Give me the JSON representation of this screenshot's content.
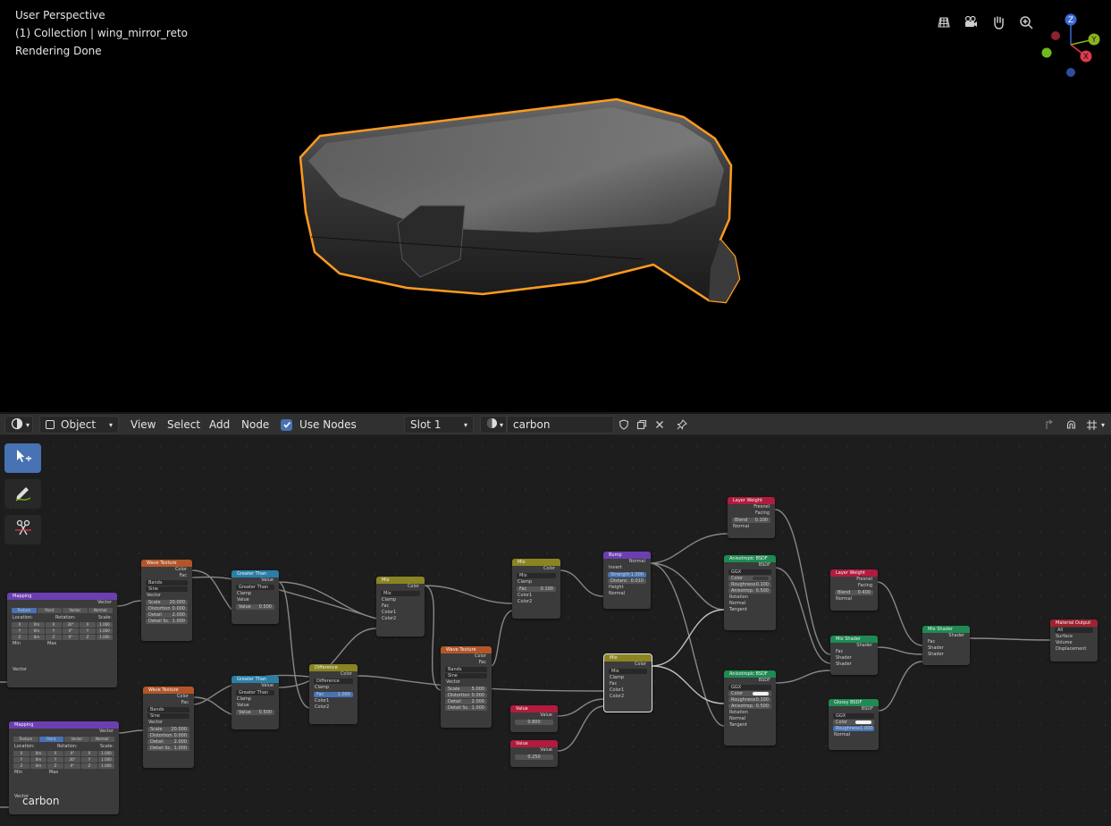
{
  "viewport": {
    "info_lines": [
      "User Perspective",
      "(1) Collection | wing_mirror_reto",
      "Rendering Done"
    ],
    "nav_buttons": [
      "grid-icon",
      "camera-icon",
      "hand-icon",
      "zoom-icon"
    ],
    "gizmo_axes": {
      "z": "Z",
      "y": "Y",
      "x": "X"
    }
  },
  "header": {
    "editor_type_icon": "shader-editor-icon",
    "mode": "Object",
    "menus": [
      "View",
      "Select",
      "Add",
      "Node"
    ],
    "use_nodes_label": "Use Nodes",
    "slot": "Slot 1",
    "material_name": "carbon"
  },
  "tools": [
    "select-box-icon",
    "annotate-icon",
    "cut-links-icon"
  ],
  "material_label": "carbon",
  "nodes": {
    "mapping1": {
      "title": "Mapping",
      "out": "Vector",
      "tabs": [
        "Texture",
        "Point",
        "Vector",
        "Normal"
      ],
      "loc": "Location:",
      "rot": "Rotation:",
      "scl": "Scale:",
      "rows": [
        [
          "X",
          "0m",
          "X",
          "30°",
          "X",
          "1.000"
        ],
        [
          "Y",
          "0m",
          "Y",
          "0°",
          "Y",
          "1.000"
        ],
        [
          "Z",
          "0m",
          "Z",
          "0°",
          "Z",
          "1.000"
        ]
      ],
      "min": "Min",
      "max": "Max",
      "in": "Vector"
    },
    "mapping2": {
      "title": "Mapping",
      "out": "Vector",
      "tabs": [
        "Texture",
        "Point",
        "Vector",
        "Normal"
      ],
      "loc": "Location:",
      "rot": "Rotation:",
      "scl": "Scale:",
      "rows": [
        [
          "X",
          "0m",
          "X",
          "0°",
          "X",
          "1.000"
        ],
        [
          "Y",
          "0m",
          "Y",
          "30°",
          "Y",
          "1.000"
        ],
        [
          "Z",
          "0m",
          "Z",
          "0°",
          "Z",
          "1.000"
        ]
      ],
      "min": "Min",
      "max": "Max",
      "in": "Vector"
    },
    "wave1": {
      "title": "Wave Texture",
      "out1": "Color",
      "out2": "Fac",
      "type": "Bands",
      "profile": "Sine",
      "in": "Vector",
      "scale": "Scale",
      "scale_v": "20.000",
      "dist": "Distortion",
      "dist_v": "0.000",
      "detail": "Detail",
      "detail_v": "2.000",
      "dscale": "Detail Sc.",
      "dscale_v": "1.000"
    },
    "wave2": {
      "title": "Wave Texture",
      "out1": "Color",
      "out2": "Fac",
      "type": "Bands",
      "profile": "Sine",
      "in": "Vector",
      "scale": "Scale",
      "scale_v": "20.000",
      "dist": "Distortion",
      "dist_v": "0.000",
      "detail": "Detail",
      "detail_v": "2.000",
      "dscale": "Detail Sc.",
      "dscale_v": "1.000"
    },
    "wave3": {
      "title": "Wave Texture",
      "out1": "Color",
      "out2": "Fac",
      "type": "Bands",
      "profile": "Sine",
      "in": "Vector",
      "scale": "Scale",
      "scale_v": "5.000",
      "dist": "Distortion",
      "dist_v": "0.000",
      "detail": "Detail",
      "detail_v": "2.000",
      "dscale": "Detail Sc.",
      "dscale_v": "1.000"
    },
    "gt1": {
      "title": "Greater Than",
      "out": "Value",
      "op": "Greater Than",
      "clamp": "Clamp",
      "in1": "Value",
      "in2": "Value",
      "in2_v": "0.500"
    },
    "gt2": {
      "title": "Greater Than",
      "out": "Value",
      "op": "Greater Than",
      "clamp": "Clamp",
      "in1": "Value",
      "in2": "Value",
      "in2_v": "0.500"
    },
    "mix1": {
      "title": "Mix",
      "out": "Color",
      "blend": "Mix",
      "clamp": "Clamp",
      "fac": "Fac",
      "c1": "Color1",
      "c2": "Color2"
    },
    "diff": {
      "title": "Difference",
      "out": "Color",
      "blend": "Difference",
      "clamp": "Clamp",
      "fac": "Fac",
      "fac_v": "1.000",
      "c1": "Color1",
      "c2": "Color2"
    },
    "mix2": {
      "title": "Mix",
      "out": "Color",
      "blend": "Mix",
      "clamp": "Clamp",
      "fac": "Fac",
      "fac_v": "0.100",
      "c1": "Color1",
      "c2": "Color2"
    },
    "bump": {
      "title": "Bump",
      "out": "Normal",
      "invert": "Invert",
      "strength": "Strength",
      "strength_v": "1.000",
      "distance": "Distanc",
      "distance_v": "0.010",
      "height": "Height",
      "normal": "Normal"
    },
    "value1": {
      "title": "Value",
      "out": "Value",
      "val": "0.800"
    },
    "value2": {
      "title": "Value",
      "out": "Value",
      "val": "0.250"
    },
    "mix3": {
      "title": "Mix",
      "out": "Color",
      "blend": "Mix",
      "clamp": "Clamp",
      "fac": "Fac",
      "c1": "Color1",
      "c2": "Color2"
    },
    "lw1": {
      "title": "Layer Weight",
      "o1": "Fresnel",
      "o2": "Facing",
      "blend": "Blend",
      "blend_v": "0.100",
      "normal": "Normal"
    },
    "lw2": {
      "title": "Layer Weight",
      "o1": "Fresnel",
      "o2": "Facing",
      "blend": "Blend",
      "blend_v": "0.400",
      "normal": "Normal"
    },
    "aniso1": {
      "title": "Anisotropic BSDF",
      "out": "BSDF",
      "dist": "GGX",
      "color": "Color",
      "rough": "Roughness",
      "rough_v": "0.100",
      "aniso": "Anisotrop.",
      "aniso_v": "0.500",
      "rot": "Rotation",
      "normal": "Normal",
      "tangent": "Tangent"
    },
    "aniso2": {
      "title": "Anisotropic BSDF",
      "out": "BSDF",
      "dist": "GGX",
      "color": "Color",
      "rough": "Roughness",
      "rough_v": "0.100",
      "aniso": "Anisotrop.",
      "aniso_v": "0.500",
      "rot": "Rotation",
      "normal": "Normal",
      "tangent": "Tangent"
    },
    "glossy": {
      "title": "Glossy BSDF",
      "out": "BSDF",
      "dist": "GGX",
      "color": "Color",
      "rough": "Roughness",
      "rough_v": "1.000",
      "normal": "Normal"
    },
    "ms1": {
      "title": "Mix Shader",
      "out": "Shader",
      "fac": "Fac",
      "s1": "Shader",
      "s2": "Shader"
    },
    "ms2": {
      "title": "Mix Shader",
      "out": "Shader",
      "fac": "Fac",
      "s1": "Shader",
      "s2": "Shader"
    },
    "output": {
      "title": "Material Output",
      "target": "All",
      "surface": "Surface",
      "volume": "Volume",
      "disp": "Displacement"
    }
  }
}
